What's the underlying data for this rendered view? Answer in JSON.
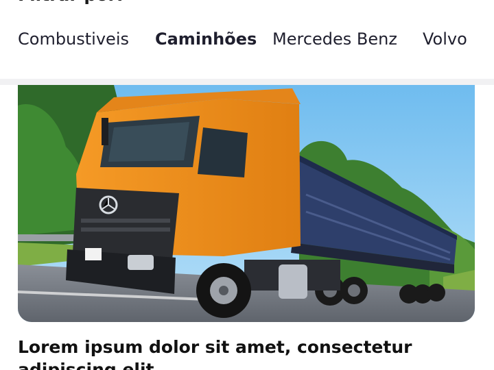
{
  "filter": {
    "heading": "Filtrar por:"
  },
  "tabs": [
    {
      "label": "Combustiveis",
      "selected": false
    },
    {
      "label": "Caminhões",
      "selected": true
    },
    {
      "label": "Mercedes Benz",
      "selected": false
    },
    {
      "label": "Volvo",
      "selected": false
    }
  ],
  "article": {
    "image_icon": "truck-photo",
    "title": "Lorem ipsum dolor sit amet, consectetur adipiscing elit"
  },
  "colors": {
    "accent": "#24233b",
    "text": "#1f1f2e",
    "separator": "#f1f1f3",
    "truck_cab": "#ef8f1f",
    "trailer_tarp": "#2e3f6b"
  }
}
